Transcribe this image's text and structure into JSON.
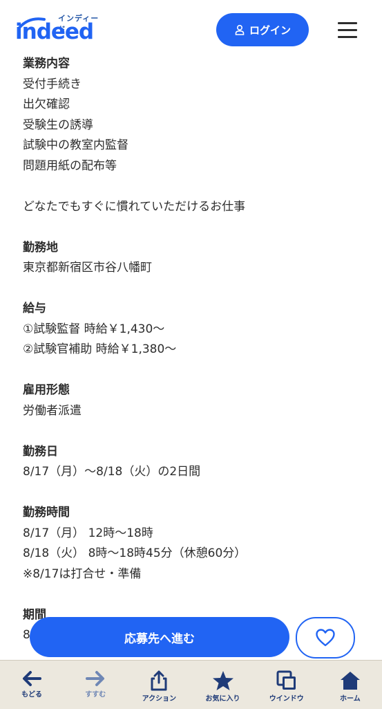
{
  "header": {
    "logo_kana": "インディード",
    "logo_word": "indeed",
    "login_label": "ログイン"
  },
  "job": {
    "sections": [
      {
        "title": "業務内容",
        "lines": [
          "受付手続き",
          "出欠確認",
          "受験生の誘導",
          "試験中の教室内監督",
          "問題用紙の配布等"
        ]
      },
      {
        "title": "",
        "lines": [
          "どなたでもすぐに慣れていただけるお仕事"
        ]
      },
      {
        "title": "勤務地",
        "lines": [
          "東京都新宿区市谷八幡町"
        ]
      },
      {
        "title": "給与",
        "lines": [
          "①試験監督 時給￥1,430〜",
          "②試験官補助 時給￥1,380〜"
        ]
      },
      {
        "title": "雇用形態",
        "lines": [
          "労働者派遣"
        ]
      },
      {
        "title": "勤務日",
        "lines": [
          "8/17（月）〜8/18（火）の2日間"
        ]
      },
      {
        "title": "勤務時間",
        "lines": [
          "8/17（月） 12時〜18時",
          "8/18（火） 8時〜18時45分（休憩60分）",
          "※8/17は打合せ・準備"
        ]
      },
      {
        "title": "期間",
        "lines": [
          "8"
        ]
      }
    ]
  },
  "actions": {
    "apply_label": "応募先へ進む"
  },
  "toolbar": {
    "back": "もどる",
    "forward": "すすむ",
    "action": "アクション",
    "favorites": "お気に入り",
    "window": "ウインドウ",
    "home": "ホーム"
  },
  "colors": {
    "brand": "#2164f3",
    "toolbar_bg": "#ece8de",
    "toolbar_icon": "#1f3b78"
  }
}
